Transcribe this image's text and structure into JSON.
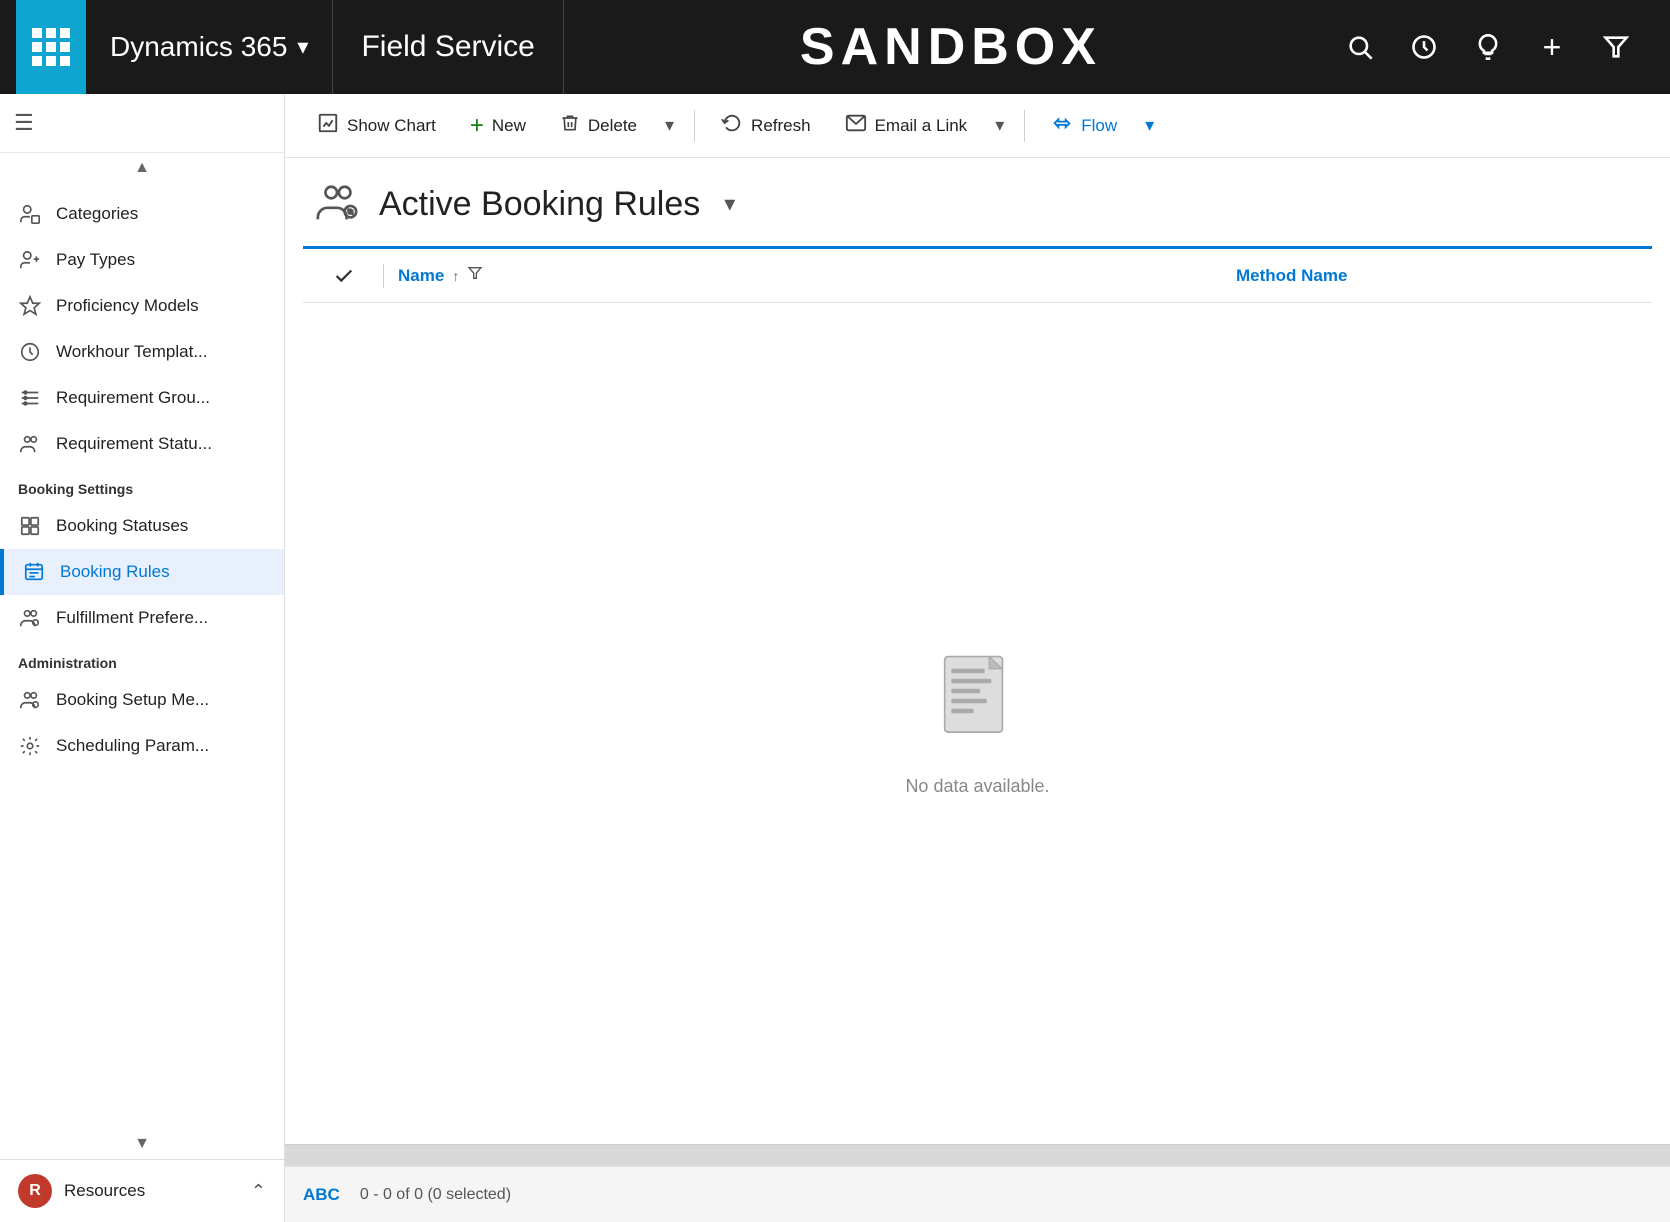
{
  "topNav": {
    "appGridLabel": "App grid",
    "dynamics365Label": "Dynamics 365",
    "fieldServiceLabel": "Field Service",
    "sandboxLabel": "SANDBOX",
    "chevronDownLabel": "▾",
    "searchIcon": "search",
    "settingsIcon": "settings",
    "lightbulbIcon": "lightbulb",
    "addIcon": "+",
    "filterIcon": "filter"
  },
  "sidebar": {
    "hamburgerLabel": "☰",
    "scrollUpLabel": "▲",
    "scrollDownLabel": "▼",
    "items": [
      {
        "id": "categories",
        "label": "Categories",
        "icon": "person-icon"
      },
      {
        "id": "pay-types",
        "label": "Pay Types",
        "icon": "person-icon"
      },
      {
        "id": "proficiency-models",
        "label": "Proficiency Models",
        "icon": "star-icon"
      },
      {
        "id": "workhour-templates",
        "label": "Workhour Templat...",
        "icon": "clock-icon"
      },
      {
        "id": "requirement-groups",
        "label": "Requirement Grou...",
        "icon": "list-icon"
      },
      {
        "id": "requirement-statuses",
        "label": "Requirement Statu...",
        "icon": "person-group-icon"
      }
    ],
    "sections": [
      {
        "header": "Booking Settings",
        "items": [
          {
            "id": "booking-statuses",
            "label": "Booking Statuses",
            "icon": "flag-icon"
          },
          {
            "id": "booking-rules",
            "label": "Booking Rules",
            "icon": "calendar-icon",
            "active": true
          },
          {
            "id": "fulfillment-preferences",
            "label": "Fulfillment Prefere...",
            "icon": "group-settings-icon"
          }
        ]
      },
      {
        "header": "Administration",
        "items": [
          {
            "id": "booking-setup",
            "label": "Booking Setup Me...",
            "icon": "group-settings-icon"
          },
          {
            "id": "scheduling-params",
            "label": "Scheduling Param...",
            "icon": "gear-icon"
          }
        ]
      }
    ],
    "bottomSection": {
      "avatarLabel": "R",
      "resourcesLabel": "Resources",
      "chevronLabel": "⌃"
    }
  },
  "toolbar": {
    "showChartLabel": "Show Chart",
    "newLabel": "New",
    "deleteLabel": "Delete",
    "refreshLabel": "Refresh",
    "emailLinkLabel": "Email a Link",
    "flowLabel": "Flow"
  },
  "pageHeader": {
    "title": "Active Booking Rules",
    "chevron": "▾"
  },
  "table": {
    "columns": [
      {
        "id": "name",
        "label": "Name"
      },
      {
        "id": "method-name",
        "label": "Method Name"
      }
    ],
    "emptyMessage": "No data available.",
    "footer": {
      "abcLabel": "ABC",
      "countLabel": "0 - 0 of 0 (0 selected)"
    }
  }
}
